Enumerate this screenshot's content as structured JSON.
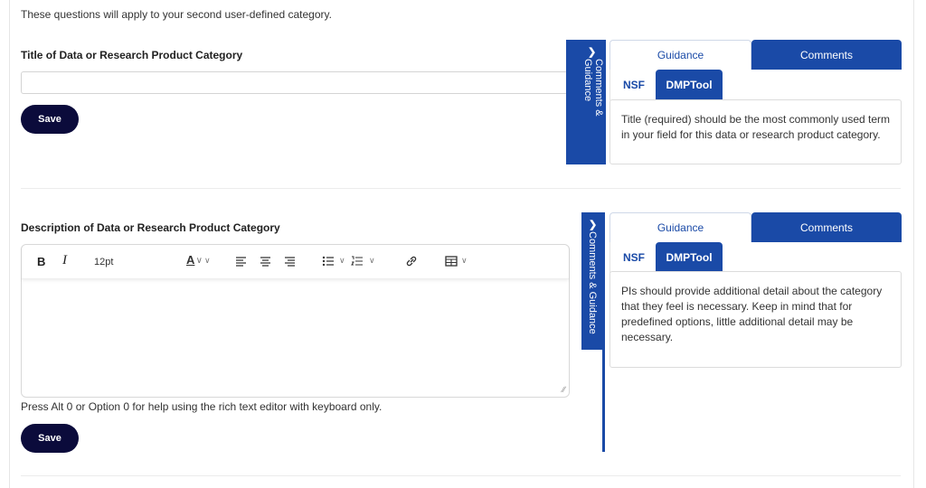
{
  "intro": "These questions will apply to your second user-defined category.",
  "question1": {
    "title": "Title of Data or Research Product Category",
    "input_value": "",
    "save_label": "Save",
    "side_tab_label": "Comments & Guidance",
    "tabs": {
      "guidance": "Guidance",
      "comments": "Comments"
    },
    "subtabs": {
      "nsf": "NSF",
      "dmptool": "DMPTool"
    },
    "guidance_text": "Title (required) should be the most commonly used term in your field for this data or research product category."
  },
  "question2": {
    "title": "Description of Data or Research Product Category",
    "editor": {
      "font_size": "12pt",
      "content": ""
    },
    "help_text": "Press Alt 0 or Option 0 for help using the rich text editor with keyboard only.",
    "save_label": "Save",
    "side_tab_label": "Comments & Guidance",
    "tabs": {
      "guidance": "Guidance",
      "comments": "Comments"
    },
    "subtabs": {
      "nsf": "NSF",
      "dmptool": "DMPTool"
    },
    "guidance_text": "PIs should provide additional detail about the category that they feel is necessary. Keep in mind that for predefined options, little additional detail may be necessary."
  },
  "colors": {
    "accent": "#1a4aa7",
    "save_button": "#0b0b3b"
  },
  "icons": [
    "chevron-right-icon",
    "bold-icon",
    "italic-icon",
    "text-color-icon",
    "align-left-icon",
    "align-center-icon",
    "align-right-icon",
    "bullet-list-icon",
    "numbered-list-icon",
    "link-icon",
    "table-icon",
    "resize-handle-icon"
  ]
}
